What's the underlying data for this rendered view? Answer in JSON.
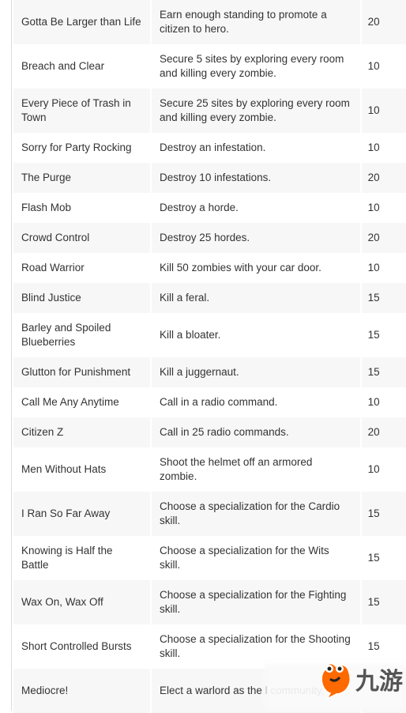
{
  "rows": [
    {
      "name": "Gotta Be Larger than Life",
      "description": "Earn enough standing to promote a citizen to hero.",
      "points": "20"
    },
    {
      "name": "Breach and Clear",
      "description": "Secure 5 sites by exploring every room and killing every zombie.",
      "points": "10"
    },
    {
      "name": "Every Piece of Trash in Town",
      "description": "Secure 25 sites by exploring every room and killing every zombie.",
      "points": "10"
    },
    {
      "name": "Sorry for Party Rocking",
      "description": "Destroy an infestation.",
      "points": "10"
    },
    {
      "name": "The Purge",
      "description": "Destroy 10 infestations.",
      "points": "20"
    },
    {
      "name": "Flash Mob",
      "description": "Destroy a horde.",
      "points": "10"
    },
    {
      "name": "Crowd Control",
      "description": "Destroy 25 hordes.",
      "points": "20"
    },
    {
      "name": "Road Warrior",
      "description": "Kill 50 zombies with your car door.",
      "points": "10"
    },
    {
      "name": "Blind Justice",
      "description": "Kill a feral.",
      "points": "15"
    },
    {
      "name": "Barley and Spoiled Blueberries",
      "description": "Kill a bloater.",
      "points": "15"
    },
    {
      "name": "Glutton for Punishment",
      "description": "Kill a juggernaut.",
      "points": "15"
    },
    {
      "name": "Call Me Any Anytime",
      "description": "Call in a radio command.",
      "points": "10"
    },
    {
      "name": "Citizen Z",
      "description": "Call in 25 radio commands.",
      "points": "20"
    },
    {
      "name": "Men Without Hats",
      "description": "Shoot the helmet off an armored zombie.",
      "points": "10"
    },
    {
      "name": "I Ran So Far Away",
      "description": "Choose a specialization for the Cardio skill.",
      "points": "15"
    },
    {
      "name": "Knowing is Half the Battle",
      "description": "Choose a specialization for the Wits skill.",
      "points": "15"
    },
    {
      "name": "Wax On, Wax Off",
      "description": "Choose a specialization for the Fighting skill.",
      "points": "15"
    },
    {
      "name": "Short Controlled Bursts",
      "description": "Choose a specialization for the Shooting skill.",
      "points": "15"
    },
    {
      "name": "Mediocre!",
      "description": "Elect a warlord as the l community.",
      "points": ""
    }
  ],
  "watermark": {
    "text": "九游",
    "color": "#ff6a00"
  }
}
